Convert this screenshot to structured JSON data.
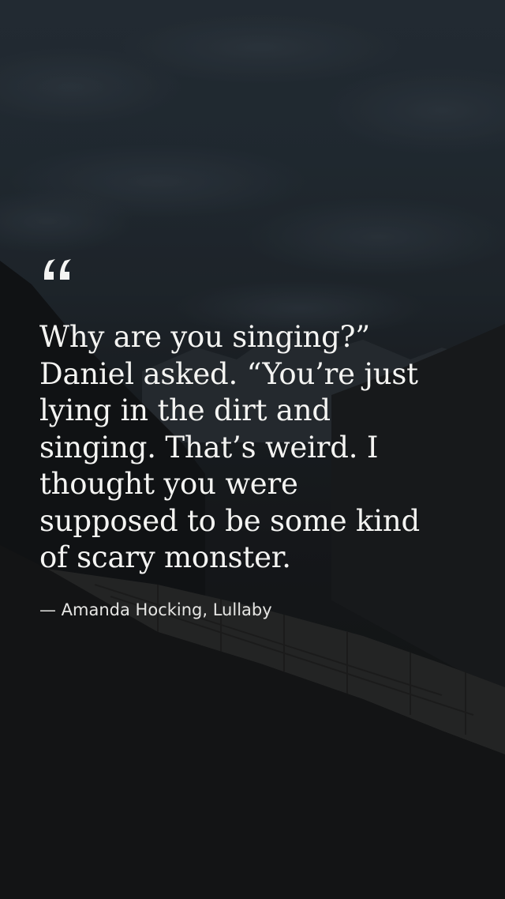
{
  "quote": {
    "mark_icon": "open-quote-icon",
    "text": "Why are you singing?”\nDaniel asked. “You’re just\nlying in the dirt and\nsinging. That’s weird. I\nthought you were\nsupposed to be some kind\nof scary monster.",
    "attribution": "— Amanda Hocking, Lullaby"
  },
  "colors": {
    "text": "#f4f4f2",
    "attribution": "#e6e6e4",
    "sky": "#27313a",
    "ground": "#141516"
  }
}
